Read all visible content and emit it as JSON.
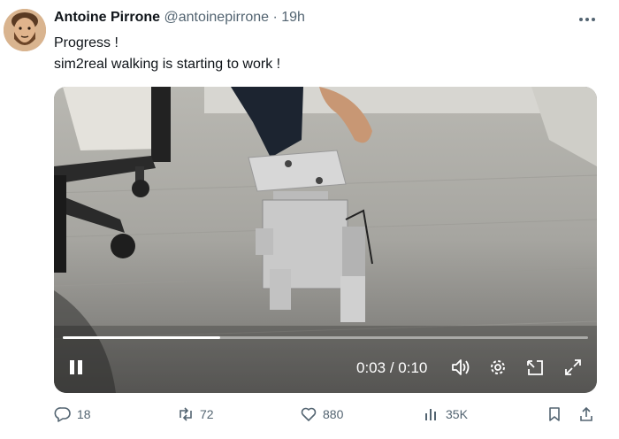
{
  "author": {
    "name": "Antoine Pirrone",
    "handle": "@antoinepirrone",
    "separator": "·",
    "time": "19h"
  },
  "tweet": {
    "lines": [
      "Progress !",
      "sim2real walking is starting to work !"
    ]
  },
  "video": {
    "current_time": "0:03",
    "separator": "/",
    "duration": "0:10",
    "progress_fraction": 0.3
  },
  "actions": {
    "replies": "18",
    "retweets": "72",
    "likes": "880",
    "views": "35K"
  },
  "colors": {
    "text_primary": "#0f1419",
    "text_secondary": "#536471",
    "background": "#ffffff"
  }
}
